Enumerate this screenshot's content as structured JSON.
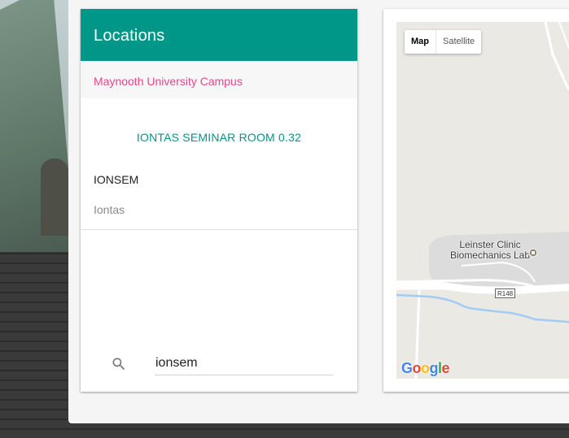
{
  "locations_card": {
    "title": "Locations",
    "campus": "Maynooth University Campus",
    "room_title": "IONTAS SEMINAR ROOM 0.32",
    "room_code": "IONSEM",
    "building": "Iontas"
  },
  "search": {
    "value": "ionsem",
    "icon": "search-icon"
  },
  "map": {
    "type_buttons": [
      "Map",
      "Satellite"
    ],
    "active_type": "Map",
    "place_label_line1": "Leinster Clinic",
    "place_label_line2": "Biomechanics Lab",
    "road_label": "R148",
    "logo_text": "Google"
  },
  "colors": {
    "header_bg": "#009688",
    "accent_teal": "#009688",
    "campus_pink": "#e8468a",
    "map_bg": "#ebe9e3",
    "water": "#a3ccf5"
  }
}
